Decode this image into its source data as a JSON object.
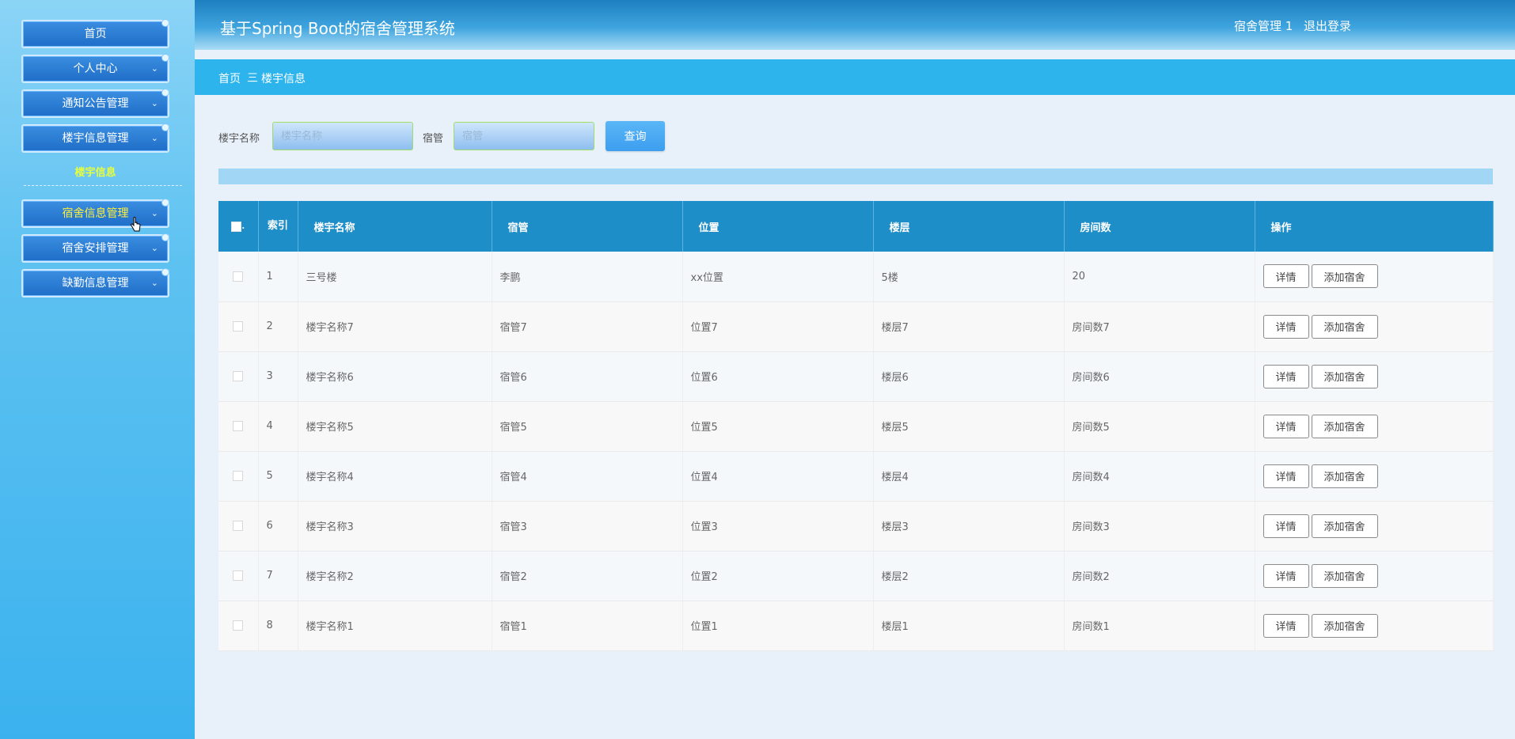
{
  "sidebar": {
    "items": [
      {
        "label": "首页",
        "top": 0
      },
      {
        "label": "个人中心"
      },
      {
        "label": "通知公告管理"
      },
      {
        "label": "楼宇信息管理"
      },
      {
        "label": "宿舍信息管理"
      },
      {
        "label": "宿舍安排管理"
      },
      {
        "label": "缺勤信息管理"
      }
    ],
    "submenu": "楼宇信息"
  },
  "header": {
    "title": "基于Spring Boot的宿舍管理系统",
    "user": "宿舍管理 1",
    "logout": "退出登录"
  },
  "breadcrumb": {
    "home": "首页",
    "separator": "三",
    "current": "楼宇信息"
  },
  "search": {
    "name_label": "楼宇名称",
    "name_placeholder": "楼宇名称",
    "manager_label": "宿管",
    "manager_placeholder": "宿管",
    "query_button": "查询"
  },
  "table": {
    "headers": {
      "index": "索引",
      "name": "楼宇名称",
      "manager": "宿管",
      "location": "位置",
      "floor": "楼层",
      "rooms": "房间数",
      "ops": "操作"
    },
    "rows": [
      {
        "index": "1",
        "name": "三号楼",
        "manager": "李鹏",
        "location": "xx位置",
        "floor": "5楼",
        "rooms": "20"
      },
      {
        "index": "2",
        "name": "楼宇名称7",
        "manager": "宿管7",
        "location": "位置7",
        "floor": "楼层7",
        "rooms": "房间数7"
      },
      {
        "index": "3",
        "name": "楼宇名称6",
        "manager": "宿管6",
        "location": "位置6",
        "floor": "楼层6",
        "rooms": "房间数6"
      },
      {
        "index": "4",
        "name": "楼宇名称5",
        "manager": "宿管5",
        "location": "位置5",
        "floor": "楼层5",
        "rooms": "房间数5"
      },
      {
        "index": "5",
        "name": "楼宇名称4",
        "manager": "宿管4",
        "location": "位置4",
        "floor": "楼层4",
        "rooms": "房间数4"
      },
      {
        "index": "6",
        "name": "楼宇名称3",
        "manager": "宿管3",
        "location": "位置3",
        "floor": "楼层3",
        "rooms": "房间数3"
      },
      {
        "index": "7",
        "name": "楼宇名称2",
        "manager": "宿管2",
        "location": "位置2",
        "floor": "楼层2",
        "rooms": "房间数2"
      },
      {
        "index": "8",
        "name": "楼宇名称1",
        "manager": "宿管1",
        "location": "位置1",
        "floor": "楼层1",
        "rooms": "房间数1"
      }
    ],
    "detail_button": "详情",
    "add_button": "添加宿舍"
  },
  "colors": {
    "sidebar": "#5ec2f1",
    "header": "#1f7fc1",
    "breadcrumb": "#2eb4ec",
    "table_header": "#1e8ec8",
    "active_menu_text": "#ffef3a"
  }
}
